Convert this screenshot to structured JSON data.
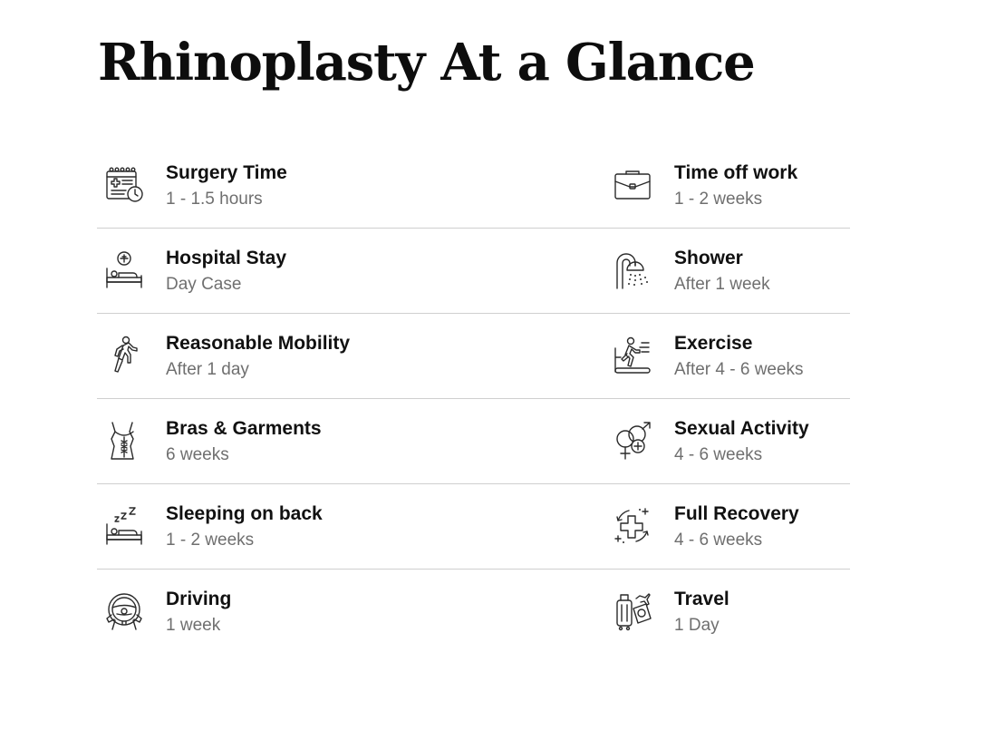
{
  "title": "Rhinoplasty At a Glance",
  "rows": [
    {
      "left": {
        "label": "Surgery Time",
        "value": "1 - 1.5 hours",
        "icon": "calendar-clock-icon"
      },
      "right": {
        "label": "Time off work",
        "value": "1 - 2 weeks",
        "icon": "briefcase-icon"
      }
    },
    {
      "left": {
        "label": "Hospital Stay",
        "value": "Day Case",
        "icon": "hospital-bed-icon"
      },
      "right": {
        "label": "Shower",
        "value": "After 1 week",
        "icon": "shower-icon"
      }
    },
    {
      "left": {
        "label": "Reasonable Mobility",
        "value": "After 1 day",
        "icon": "walking-person-icon"
      },
      "right": {
        "label": "Exercise",
        "value": "After 4 - 6 weeks",
        "icon": "treadmill-icon"
      }
    },
    {
      "left": {
        "label": "Bras & Garments",
        "value": "6 weeks",
        "icon": "corset-icon"
      },
      "right": {
        "label": "Sexual Activity",
        "value": "4 - 6 weeks",
        "icon": "gender-symbols-icon"
      }
    },
    {
      "left": {
        "label": "Sleeping on back",
        "value": "1 - 2 weeks",
        "icon": "sleeping-bed-icon"
      },
      "right": {
        "label": "Full Recovery",
        "value": "4 - 6 weeks",
        "icon": "medical-cross-recovery-icon"
      }
    },
    {
      "left": {
        "label": "Driving",
        "value": "1 week",
        "icon": "steering-wheel-icon"
      },
      "right": {
        "label": "Travel",
        "value": "1 Day",
        "icon": "luggage-travel-icon"
      }
    }
  ]
}
